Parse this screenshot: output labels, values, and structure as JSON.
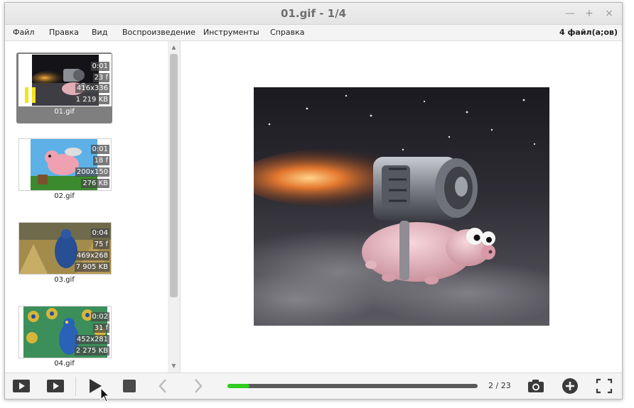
{
  "window": {
    "title": "01.gif - 1/4",
    "minimize_glyph": "—",
    "maximize_glyph": "+",
    "close_glyph": "×"
  },
  "menu": {
    "items": [
      "Файл",
      "Правка",
      "Вид",
      "Воспроизведение",
      "Инструменты",
      "Справка"
    ],
    "file_count": "4 файл(а;ов)"
  },
  "thumbnails": [
    {
      "name": "01.gif",
      "duration": "0:01",
      "frames": "23 f",
      "size": "416x336",
      "filesize": "1 219 KB",
      "selected": true,
      "paused": true
    },
    {
      "name": "02.gif",
      "duration": "0:01",
      "frames": "18 f",
      "size": "200x150",
      "filesize": "276 KB",
      "selected": false,
      "paused": false
    },
    {
      "name": "03.gif",
      "duration": "0:04",
      "frames": "75 f",
      "size": "469x268",
      "filesize": "7 905 KB",
      "selected": false,
      "paused": false
    },
    {
      "name": "04.gif",
      "duration": "0:02",
      "frames": "31 f",
      "size": "452x281",
      "filesize": "2 275 KB",
      "selected": false,
      "paused": false
    }
  ],
  "playback": {
    "progress": 0.087,
    "frame_counter": "2 / 23"
  },
  "toolbar_icons": [
    "slideshow-icon",
    "play-next-icon",
    "play-icon",
    "stop-icon",
    "prev-arrow-icon",
    "next-arrow-icon",
    "camera-icon",
    "add-icon",
    "fullscreen-icon"
  ],
  "colors": {
    "progress_green": "#2ecc1f",
    "selection_gray": "#7f7f7f",
    "pause_yellow": "#f6e11a"
  }
}
